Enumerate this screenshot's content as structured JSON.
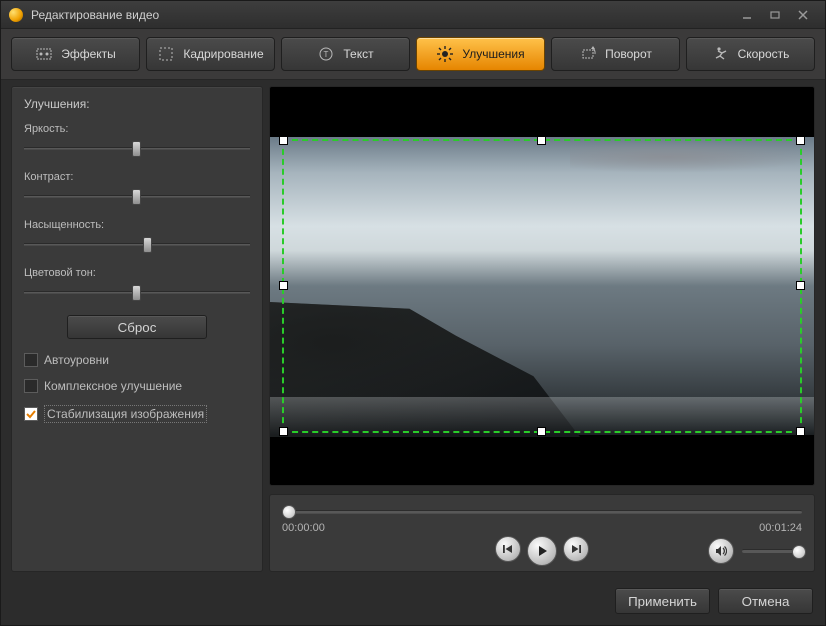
{
  "window": {
    "title": "Редактирование видео"
  },
  "tabs": [
    {
      "id": "effects",
      "label": "Эффекты"
    },
    {
      "id": "crop",
      "label": "Кадрирование"
    },
    {
      "id": "text",
      "label": "Текст"
    },
    {
      "id": "enhance",
      "label": "Улучшения",
      "active": true
    },
    {
      "id": "rotate",
      "label": "Поворот"
    },
    {
      "id": "speed",
      "label": "Скорость"
    }
  ],
  "enhance_panel": {
    "title": "Улучшения:",
    "sliders": {
      "brightness": {
        "label": "Яркость:",
        "value": 50
      },
      "contrast": {
        "label": "Контраст:",
        "value": 50
      },
      "saturation": {
        "label": "Насыщенность:",
        "value": 55
      },
      "hue": {
        "label": "Цветовой тон:",
        "value": 50
      }
    },
    "reset_label": "Сброс",
    "checks": {
      "auto_levels": {
        "label": "Автоуровни",
        "checked": false
      },
      "complex": {
        "label": "Комплексное улучшение",
        "checked": false
      },
      "stabilize": {
        "label": "Стабилизация изображения",
        "checked": true
      }
    }
  },
  "player": {
    "current_time": "00:00:00",
    "duration": "00:01:24",
    "position": 0,
    "volume": 100
  },
  "footer": {
    "apply": "Применить",
    "cancel": "Отмена"
  }
}
